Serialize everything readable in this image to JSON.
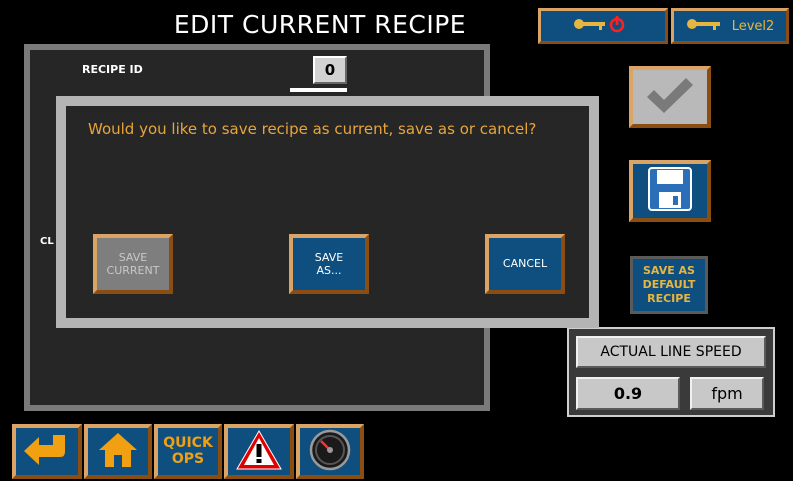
{
  "header": {
    "title": "EDIT CURRENT RECIPE",
    "logout_icon": "key-power-icon",
    "level_label": "Level2"
  },
  "panel": {
    "recipe_id_label": "RECIPE ID",
    "recipe_id_value": "0",
    "partial_label": "CL"
  },
  "dialog": {
    "message": "Would you like to save recipe as current, save as or cancel?",
    "save_current_line1": "SAVE",
    "save_current_line2": "CURRENT",
    "save_as_line1": "SAVE",
    "save_as_line2": "AS...",
    "cancel_label": "CANCEL"
  },
  "side": {
    "confirm_icon": "checkmark-icon",
    "save_icon": "floppy-disk-icon",
    "default_line1": "SAVE AS",
    "default_line2": "DEFAULT",
    "default_line3": "RECIPE"
  },
  "line_speed": {
    "label": "ACTUAL LINE SPEED",
    "value": "0.9",
    "unit": "fpm"
  },
  "nav": {
    "back_icon": "back-arrow-icon",
    "home_icon": "home-icon",
    "quick_line1": "QUICK",
    "quick_line2": "OPS",
    "alarm_icon": "warning-icon",
    "gauge_icon": "speedometer-icon"
  },
  "colors": {
    "button_blue": "#0f4f80",
    "button_border": "#d9a466",
    "accent_orange": "#e7a53a",
    "panel_bg": "#262626"
  }
}
